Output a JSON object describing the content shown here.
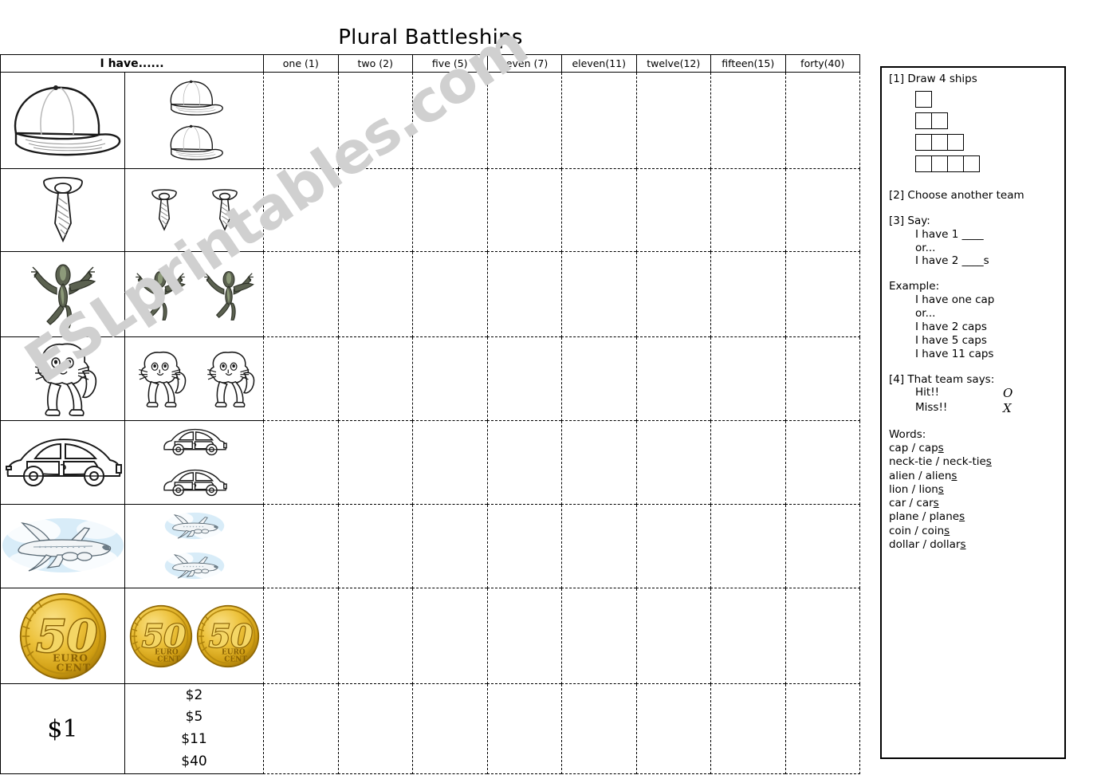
{
  "document": {
    "title": "Plural Battleships",
    "watermark": "ESLprintables.com"
  },
  "table": {
    "row_header_label": "I have......",
    "column_headers": [
      "one (1)",
      "two (2)",
      "five (5)",
      "seven (7)",
      "eleven(11)",
      "twelve(12)",
      "fifteen(15)",
      "forty(40)"
    ],
    "rows": [
      {
        "singular_icon": "cap-icon",
        "plural_icon": "two-caps-icon",
        "plural_count": 2,
        "plural_arrangement": "vertical",
        "word": "cap"
      },
      {
        "singular_icon": "neck-tie-icon",
        "plural_icon": "two-neck-ties-icon",
        "plural_count": 2,
        "plural_arrangement": "horizontal",
        "word": "neck-tie"
      },
      {
        "singular_icon": "alien-icon",
        "plural_icon": "two-aliens-icon",
        "plural_count": 2,
        "plural_arrangement": "horizontal",
        "word": "alien"
      },
      {
        "singular_icon": "lion-icon",
        "plural_icon": "two-lions-icon",
        "plural_count": 2,
        "plural_arrangement": "horizontal",
        "word": "lion"
      },
      {
        "singular_icon": "car-icon",
        "plural_icon": "two-cars-icon",
        "plural_count": 2,
        "plural_arrangement": "vertical",
        "word": "car"
      },
      {
        "singular_icon": "plane-icon",
        "plural_icon": "two-planes-icon",
        "plural_count": 2,
        "plural_arrangement": "vertical",
        "word": "plane"
      },
      {
        "singular_icon": "euro-50-cent-coin-icon",
        "plural_icon": "two-euro-50-cent-coins-icon",
        "plural_count": 2,
        "plural_arrangement": "horizontal",
        "word": "coin"
      },
      {
        "singular_text": "$1",
        "plural_text_list": [
          "$2",
          "$5",
          "$11",
          "$40"
        ],
        "word": "dollar"
      }
    ]
  },
  "panel": {
    "step1": "[1] Draw 4 ships",
    "ships": [
      1,
      2,
      3,
      4
    ],
    "step2": "[2] Choose another team",
    "step3": "[3] Say:",
    "say_lines": [
      "I have 1 ____",
      "or...",
      "I have 2 ____s"
    ],
    "example_label": "Example:",
    "example_lines": [
      "I have one cap",
      "or...",
      "I have 2 caps",
      "I have 5 caps",
      "I have 11 caps"
    ],
    "step4": "[4] That team says:",
    "results": [
      {
        "label": "Hit!!",
        "mark": "O"
      },
      {
        "label": "Miss!!",
        "mark": "X"
      }
    ],
    "words_label": "Words:",
    "words": [
      {
        "singular": "cap",
        "plural_stem": "cap",
        "plural_suffix": "s"
      },
      {
        "singular": "neck-tie",
        "plural_stem": "neck-tie",
        "plural_suffix": "s"
      },
      {
        "singular": "alien",
        "plural_stem": "alien",
        "plural_suffix": "s"
      },
      {
        "singular": "lion",
        "plural_stem": "lion",
        "plural_suffix": "s"
      },
      {
        "singular": "car",
        "plural_stem": "car",
        "plural_suffix": "s"
      },
      {
        "singular": "plane",
        "plural_stem": "plane",
        "plural_suffix": "s"
      },
      {
        "singular": "coin",
        "plural_stem": "coin",
        "plural_suffix": "s"
      },
      {
        "singular": "dollar",
        "plural_stem": "dollar",
        "plural_suffix": "s"
      }
    ]
  },
  "colors": {
    "ink": "#000000",
    "watermark": "#d0d0d0",
    "coin_gold": "#e8b51c",
    "coin_gold_dark": "#a9800d",
    "sky_blue": "#cfe8f7"
  }
}
